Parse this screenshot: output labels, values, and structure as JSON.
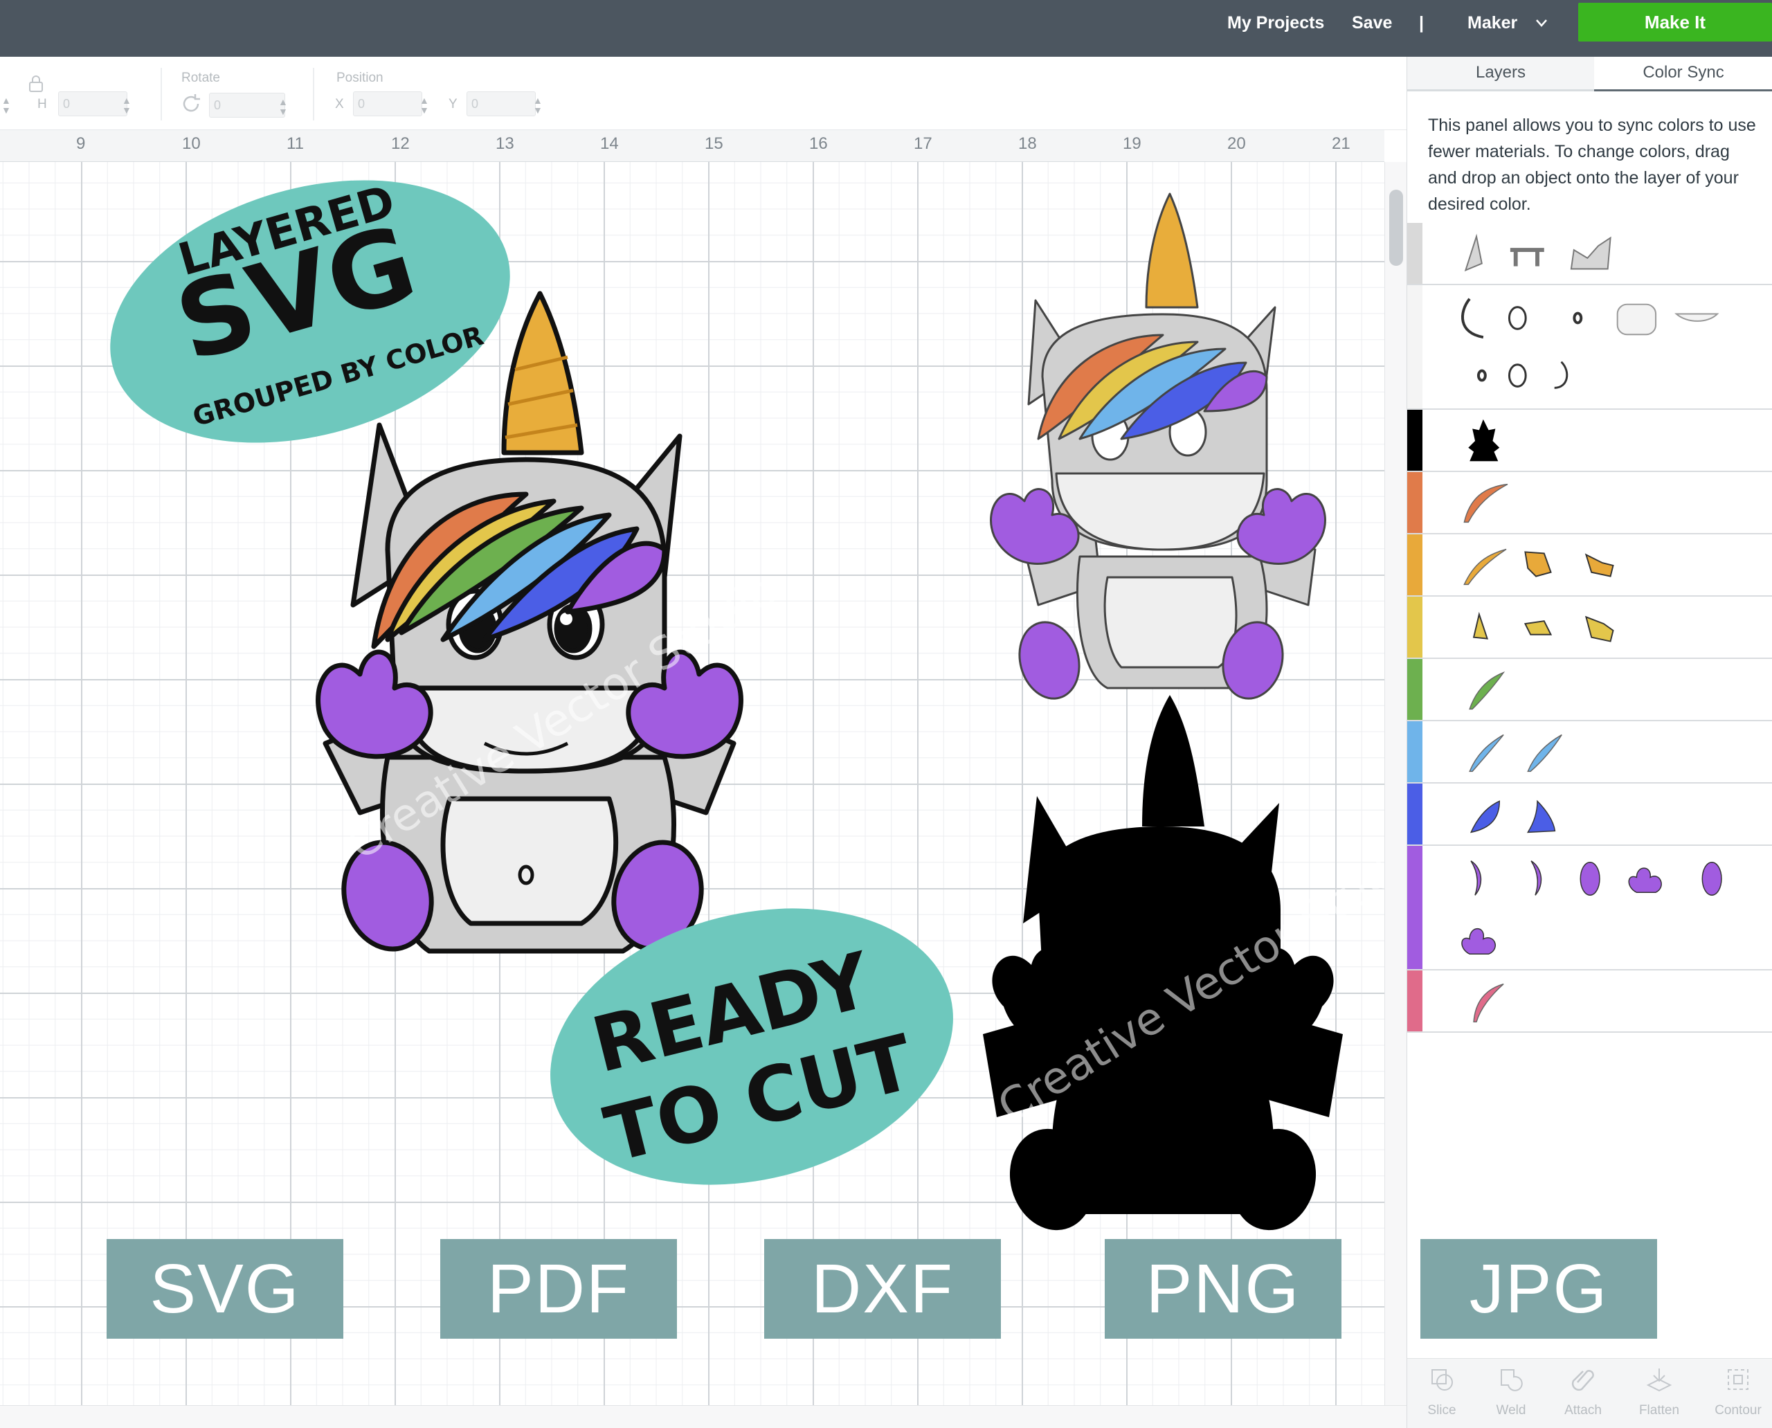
{
  "topbar": {
    "my_projects": "My Projects",
    "save": "Save",
    "separator": "|",
    "machine": "Maker",
    "make_it": "Make It",
    "colors": {
      "bar": "#4c5660",
      "make_it": "#3ab520"
    }
  },
  "edit_toolbar": {
    "size_label": "H",
    "size_value": "0",
    "rotate_label": "Rotate",
    "rotate_value": "0",
    "position_label": "Position",
    "x_label": "X",
    "x_value": "0",
    "y_label": "Y",
    "y_value": "0"
  },
  "ruler": {
    "numbers": [
      "9",
      "10",
      "11",
      "12",
      "13",
      "14",
      "15",
      "16",
      "17",
      "18",
      "19",
      "20",
      "21"
    ]
  },
  "artwork": {
    "badge_top": {
      "line1": "LAYERED",
      "line2": "SVG",
      "line3": "GROUPED BY COLOR"
    },
    "badge_bottom": {
      "line1": "READY",
      "line2": "TO CUT"
    },
    "watermark": "Creative Vector Studio",
    "badge_color": "#6ec8bd"
  },
  "formats": [
    "SVG",
    "PDF",
    "DXF",
    "PNG",
    "JPG"
  ],
  "format_badge_color": "#7fa6a7",
  "panel": {
    "tabs": {
      "layers": "Layers",
      "color_sync": "Color Sync"
    },
    "description": "This panel allows you to sync colors to use fewer materials. To change colors, drag and drop an object onto the layer of your desired color.",
    "sync_rows": [
      {
        "swatch": "#d9d9d9",
        "icons": [
          "ear-shape-icon",
          "nostril-shape-icon",
          "crown-shape-icon"
        ]
      },
      {
        "swatch": "#ffffff",
        "icons": [
          "cheek-arc-icon",
          "eye-outline-icon",
          "eye-dot-icon",
          "face-blob-icon",
          "smile-icon",
          "eye-dot-icon",
          "eye-outline-icon",
          "hoof-arc-icon"
        ]
      },
      {
        "swatch": "#000000",
        "icons": [
          "unicorn-silhouette-icon"
        ]
      },
      {
        "swatch": "#e07b4a",
        "icons": [
          "hair-strand-icon"
        ]
      },
      {
        "swatch": "#e8a93a",
        "icons": [
          "hair-strand-icon",
          "horn-segment-icon",
          "horn-segment-icon"
        ]
      },
      {
        "swatch": "#e3c64b",
        "icons": [
          "horn-tip-icon",
          "horn-segment-icon",
          "horn-segment-icon"
        ]
      },
      {
        "swatch": "#6db04f",
        "icons": [
          "hair-strand-icon"
        ]
      },
      {
        "swatch": "#6fb4ea",
        "icons": [
          "hair-strand-icon",
          "hair-strand-icon"
        ]
      },
      {
        "swatch": "#4b5ee6",
        "icons": [
          "hair-blade-icon",
          "hair-blade-icon"
        ]
      },
      {
        "swatch": "#a15ce0",
        "icons": [
          "hair-curl-icon",
          "hair-curl-icon",
          "foot-oval-icon",
          "hoof-paw-icon",
          "foot-oval-icon",
          "hoof-paw-icon"
        ]
      },
      {
        "swatch": "#e06b8a",
        "icons": [
          "hair-strand-icon"
        ]
      }
    ],
    "tools": [
      "Slice",
      "Weld",
      "Attach",
      "Flatten",
      "Contour"
    ]
  }
}
